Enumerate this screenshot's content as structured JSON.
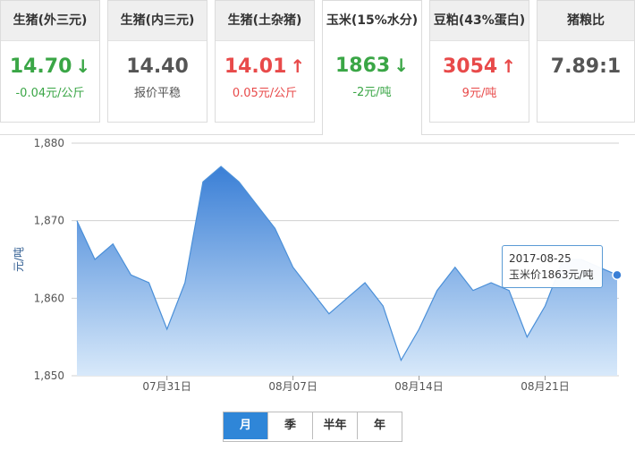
{
  "cards": [
    {
      "title": "生猪(外三元)",
      "value": "14.70",
      "trend": "down",
      "sub": "-0.04元/公斤"
    },
    {
      "title": "生猪(内三元)",
      "value": "14.40",
      "trend": "none",
      "sub": "报价平稳"
    },
    {
      "title": "生猪(土杂猪)",
      "value": "14.01",
      "trend": "up",
      "sub": "0.05元/公斤"
    },
    {
      "title": "玉米(15%水分)",
      "value": "1863",
      "trend": "down",
      "sub": "-2元/吨"
    },
    {
      "title": "豆粕(43%蛋白)",
      "value": "3054",
      "trend": "up",
      "sub": "9元/吨"
    },
    {
      "title": "猪粮比",
      "value": "7.89:1",
      "trend": "none",
      "sub": ""
    }
  ],
  "arrows": {
    "up": "↑",
    "down": "↓"
  },
  "colors": {
    "down": "#3aa646",
    "up": "#e84a4a",
    "line": "#4a8fd8",
    "fill_top": "#3a7fd6",
    "fill_bottom": "#d8e9fa",
    "grid": "#d0d0d0"
  },
  "chart_data": {
    "type": "area",
    "ylabel": "元/吨",
    "ylim": [
      1850,
      1880
    ],
    "yticks": [
      1850,
      1860,
      1870,
      1880
    ],
    "ytick_labels": [
      "1,850",
      "1,860",
      "1,870",
      "1,880"
    ],
    "x": [
      "2017-07-26",
      "2017-07-27",
      "2017-07-28",
      "2017-07-29",
      "2017-07-30",
      "2017-07-31",
      "2017-08-01",
      "2017-08-02",
      "2017-08-03",
      "2017-08-04",
      "2017-08-05",
      "2017-08-06",
      "2017-08-07",
      "2017-08-08",
      "2017-08-09",
      "2017-08-10",
      "2017-08-11",
      "2017-08-12",
      "2017-08-13",
      "2017-08-14",
      "2017-08-15",
      "2017-08-16",
      "2017-08-17",
      "2017-08-18",
      "2017-08-19",
      "2017-08-20",
      "2017-08-21",
      "2017-08-22",
      "2017-08-23",
      "2017-08-24",
      "2017-08-25"
    ],
    "values": [
      1870,
      1865,
      1867,
      1863,
      1862,
      1856,
      1862,
      1875,
      1877,
      1875,
      1872,
      1869,
      1864,
      1861,
      1858,
      1860,
      1862,
      1859,
      1852,
      1856,
      1861,
      1864,
      1861,
      1862,
      1861,
      1855,
      1859,
      1865,
      1865,
      1864,
      1863
    ],
    "xtick_labels": [
      {
        "date": "2017-07-31",
        "label": "07月31日"
      },
      {
        "date": "2017-08-07",
        "label": "08月07日"
      },
      {
        "date": "2017-08-14",
        "label": "08月14日"
      },
      {
        "date": "2017-08-21",
        "label": "08月21日"
      }
    ],
    "highlight": {
      "date": "2017-08-25",
      "value": 1863
    }
  },
  "tooltip": {
    "date": "2017-08-25",
    "text": "玉米价1863元/吨"
  },
  "ranges": [
    {
      "label": "月",
      "active": true
    },
    {
      "label": "季",
      "active": false
    },
    {
      "label": "半年",
      "active": false
    },
    {
      "label": "年",
      "active": false
    }
  ]
}
